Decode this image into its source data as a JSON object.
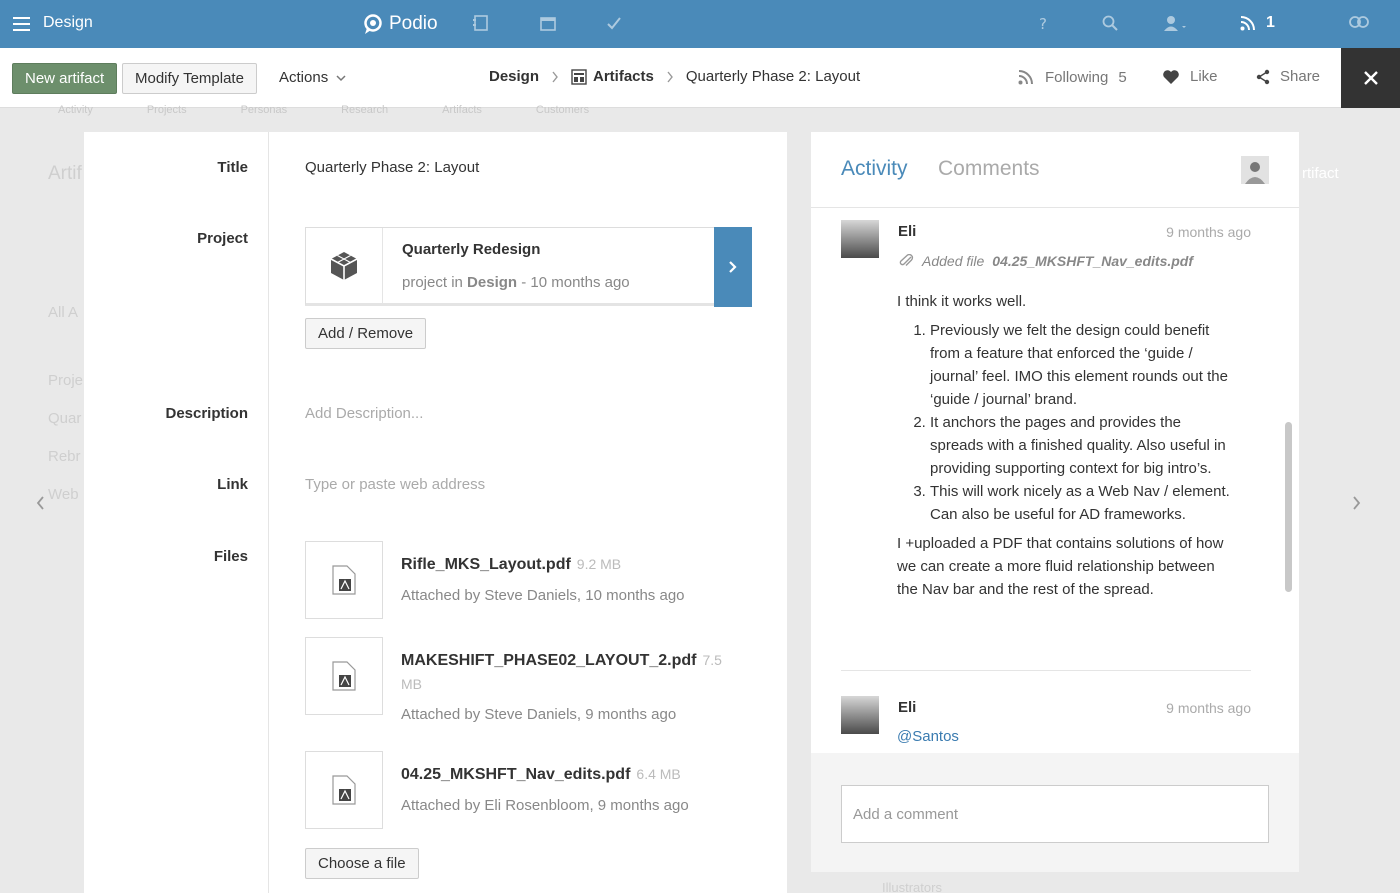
{
  "topbar": {
    "workspace_title": "Design",
    "logo_text": "Podio",
    "notification_count": "1"
  },
  "actionbar": {
    "new_artifact_label": "New artifact",
    "modify_template_label": "Modify Template",
    "actions_label": "Actions",
    "breadcrumb": {
      "workspace": "Design",
      "app": "Artifacts",
      "item": "Quarterly Phase 2: Layout"
    },
    "following_label": "Following",
    "following_count": "5",
    "like_label": "Like",
    "share_label": "Share"
  },
  "background": {
    "tabs": [
      "Activity",
      "Projects",
      "Personas",
      "Research",
      "Artifacts",
      "Customers"
    ],
    "fragments": {
      "artifacts_heading": "Artif",
      "all_artifacts": "All A",
      "projects": "Proje",
      "quarterly": "Quar",
      "rebrand": "Rebr",
      "web": "Web",
      "new_artifact_right": "rtifact",
      "illustrators": "Illustrators"
    }
  },
  "fields": {
    "title_label": "Title",
    "title_value": "Quarterly Phase 2: Layout",
    "project_label": "Project",
    "project": {
      "name": "Quarterly Redesign",
      "sub_prefix": "project in",
      "sub_workspace": "Design",
      "sub_suffix": "- 10 months ago"
    },
    "add_remove_label": "Add / Remove",
    "description_label": "Description",
    "description_placeholder": "Add Description...",
    "link_label": "Link",
    "link_placeholder": "Type or paste web address",
    "files_label": "Files",
    "files": [
      {
        "name": "Rifle_MKS_Layout.pdf",
        "size": "9.2 MB",
        "meta": "Attached by Steve Daniels, 10 months ago"
      },
      {
        "name": "MAKESHIFT_PHASE02_LAYOUT_2.pdf",
        "size_a": "7.5",
        "size_b": "MB",
        "meta": "Attached by Steve Daniels, 9 months ago"
      },
      {
        "name": "04.25_MKSHFT_Nav_edits.pdf",
        "size": "6.4 MB",
        "meta": "Attached by Eli Rosenbloom, 9 months ago"
      }
    ],
    "choose_file_label": "Choose a file"
  },
  "side": {
    "tab_activity": "Activity",
    "tab_comments": "Comments",
    "entries": [
      {
        "name": "Eli",
        "time": "9 months ago",
        "file_prefix": "Added file",
        "file_name": "04.25_MKSHFT_Nav_edits.pdf",
        "intro": "I think it works well.",
        "points": [
          "Previously we felt the design could benefit from a feature that enforced the ‘guide / journal’ feel. IMO this element rounds out the ‘guide / journal’ brand.",
          "It anchors the pages and provides the spreads with a finished quality. Also useful in providing supporting context for big intro’s.",
          "This will work nicely as a Web Nav / element. Can also be useful for AD frameworks."
        ],
        "outro": "I +uploaded a PDF that contains solutions of how we can create a more fluid relationship between the Nav bar and the rest of the spread."
      },
      {
        "name": "Eli",
        "time": "9 months ago",
        "mention": "@Santos"
      }
    ],
    "comment_placeholder": "Add a comment"
  },
  "colors": {
    "topbar": "#4a8ab9",
    "primary_button": "#6d8f6c",
    "link": "#3a7bb0"
  }
}
